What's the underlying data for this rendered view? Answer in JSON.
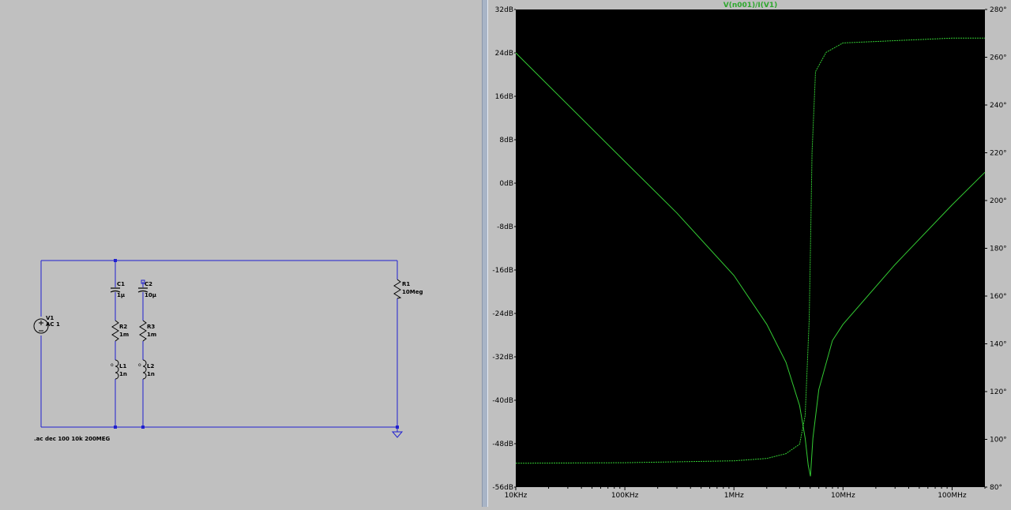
{
  "schematic": {
    "components": [
      {
        "ref": "V1",
        "value": "AC 1"
      },
      {
        "ref": "C1",
        "value": "1µ"
      },
      {
        "ref": "R2",
        "value": "1m"
      },
      {
        "ref": "L1",
        "value": "1n"
      },
      {
        "ref": "C2",
        "value": "10µ"
      },
      {
        "ref": "R3",
        "value": "1m"
      },
      {
        "ref": "L2",
        "value": "1n"
      },
      {
        "ref": "R1",
        "value": "10Meg"
      }
    ],
    "directive": ".ac dec 100 10k 200MEG",
    "colors": {
      "wire": "#2020d0",
      "text": "#000000"
    }
  },
  "plot": {
    "trace_title": "V(n001)/I(V1)",
    "colors": {
      "background": "#000000",
      "trace": "#33cc33",
      "axis_text": "#000000"
    },
    "chart_data": {
      "type": "line",
      "title": "V(n001)/I(V1)",
      "x_scale": "log",
      "xlim": [
        10000,
        200000000
      ],
      "x_ticks": [
        "10KHz",
        "100KHz",
        "1MHz",
        "10MHz",
        "100MHz"
      ],
      "y_left_ticks": [
        "32dB",
        "24dB",
        "16dB",
        "8dB",
        "0dB",
        "-8dB",
        "-16dB",
        "-24dB",
        "-32dB",
        "-40dB",
        "-48dB",
        "-56dB"
      ],
      "y_left_lim": [
        -56,
        32
      ],
      "y_right_ticks": [
        "280°",
        "260°",
        "240°",
        "220°",
        "200°",
        "180°",
        "160°",
        "140°",
        "120°",
        "100°",
        "80°"
      ],
      "y_right_lim": [
        80,
        280
      ],
      "grid": false,
      "series": [
        {
          "axis": "left",
          "x": [
            10000,
            100000,
            300000,
            1000000,
            2000000,
            3000000,
            4000000,
            4500000,
            4800000,
            5033000,
            5300000,
            6000000,
            8000000,
            10000000,
            30000000,
            100000000,
            200000000
          ],
          "y": [
            24,
            4,
            -5.5,
            -17,
            -26,
            -33,
            -41,
            -47,
            -52,
            -54,
            -47,
            -38,
            -29,
            -26,
            -15,
            -4,
            2
          ]
        },
        {
          "axis": "right",
          "x": [
            10000,
            100000,
            1000000,
            2000000,
            3000000,
            4000000,
            4500000,
            4900000,
            5033000,
            5200000,
            5600000,
            7000000,
            10000000,
            100000000,
            200000000
          ],
          "y": [
            90,
            90.2,
            91,
            92,
            94,
            98,
            110,
            150,
            180,
            220,
            254,
            262,
            266,
            268,
            268
          ]
        }
      ]
    }
  }
}
